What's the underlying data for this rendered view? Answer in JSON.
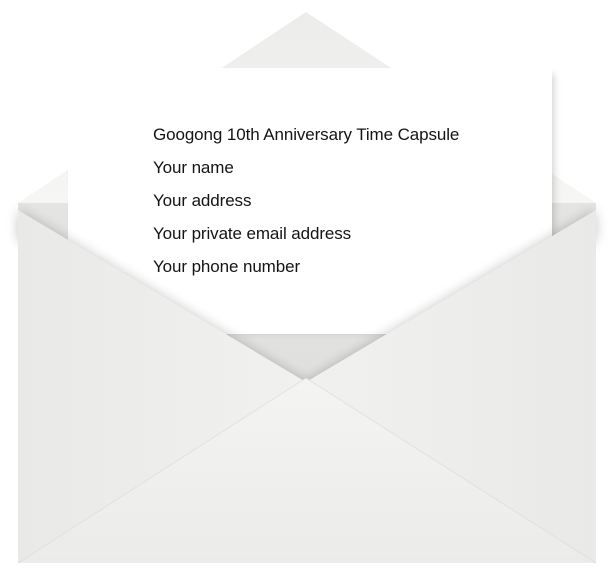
{
  "letter": {
    "lines": [
      "Googong 10th Anniversary Time Capsule",
      "Your name",
      "Your address",
      "Your private email address",
      "Your phone number"
    ]
  },
  "colors": {
    "envelope_back": "#ebebea",
    "envelope_flap": "#f3f3f1",
    "envelope_front": "#f1f1ef",
    "letter_paper": "#ffffff",
    "text": "#141414"
  }
}
